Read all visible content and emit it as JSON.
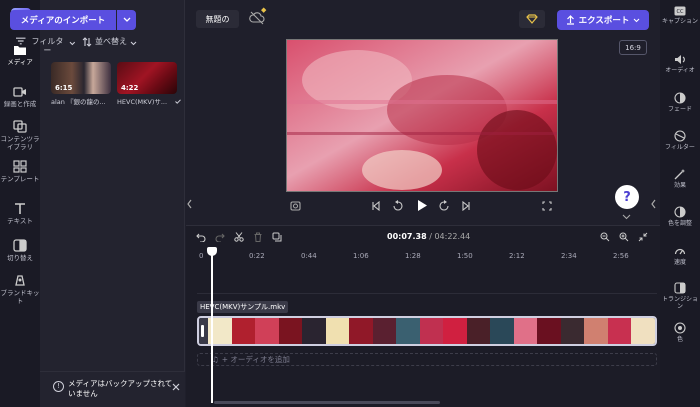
{
  "left_rail": {
    "items": [
      {
        "label": "メディア",
        "icon": "folder-icon"
      },
      {
        "label": "録画と作成",
        "icon": "camera-icon"
      },
      {
        "label": "コンテンツライブラリ",
        "icon": "library-icon"
      },
      {
        "label": "テンプレート",
        "icon": "template-icon"
      },
      {
        "label": "テキスト",
        "icon": "text-icon"
      },
      {
        "label": "切り替え",
        "icon": "transition-icon"
      },
      {
        "label": "ブランドキット",
        "icon": "brand-kit-icon"
      }
    ]
  },
  "media_panel": {
    "import_label": "メディアのインポート",
    "filter_label": "フィルター",
    "sort_label": "並べ替え",
    "items": [
      {
        "duration": "6:15",
        "name": "alan 『銀の龍の..."
      },
      {
        "duration": "4:22",
        "name": "HEVC(MKV)サ..."
      }
    ],
    "backup_text": "メディアはバックアップされていません"
  },
  "topbar": {
    "project_name": "無題の",
    "export_label": "エクスポート"
  },
  "preview": {
    "aspect_ratio": "16:9"
  },
  "help_label": "?",
  "right_rail": {
    "items": [
      {
        "label": "キャプション",
        "icon": "captions-icon"
      },
      {
        "label": "オーディオ",
        "icon": "audio-icon"
      },
      {
        "label": "フェード",
        "icon": "fade-icon"
      },
      {
        "label": "フィルター",
        "icon": "filter-icon"
      },
      {
        "label": "効果",
        "icon": "effects-icon"
      },
      {
        "label": "色を調整",
        "icon": "color-adjust-icon"
      },
      {
        "label": "速度",
        "icon": "speed-icon"
      },
      {
        "label": "トランジション",
        "icon": "transition-icon"
      },
      {
        "label": "色",
        "icon": "color-icon"
      }
    ]
  },
  "timeline": {
    "current_time": "00:07.38",
    "total_time": "04:22.44",
    "ticks": [
      "0",
      "0:22",
      "0:44",
      "1:06",
      "1:28",
      "1:50",
      "2:12",
      "2:34",
      "2:56"
    ],
    "clip_label": "HEVC(MKV)サンプル.mkv",
    "add_audio_label": "+ オーディオを追加"
  },
  "colors": {
    "accent": "#5a4fe0",
    "background": "#1f1f2b"
  }
}
